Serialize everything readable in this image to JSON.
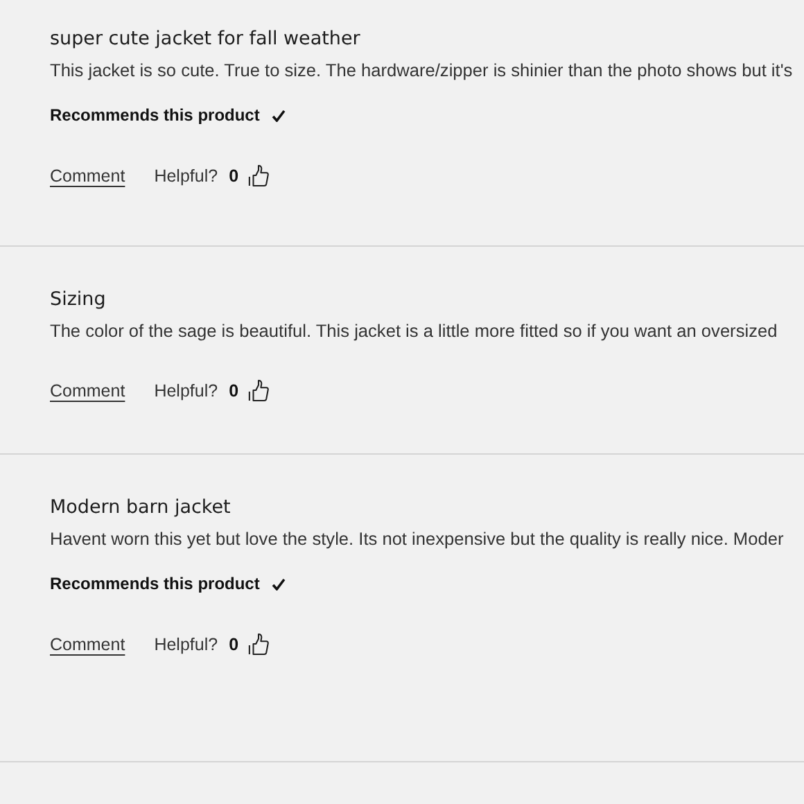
{
  "reviews": [
    {
      "title": "super cute jacket for fall weather",
      "body": "This jacket is so cute. True to size. The hardware/zipper is shinier than the photo shows but it's",
      "recommends": true,
      "recommend_label": "Recommends this product",
      "comment": "Comment",
      "helpful_label": "Helpful?",
      "helpful_count": "0"
    },
    {
      "title": "Sizing",
      "body": "The color of the sage is beautiful. This jacket is a little more fitted so if you want an oversized",
      "recommends": false,
      "comment": "Comment",
      "helpful_label": "Helpful?",
      "helpful_count": "0"
    },
    {
      "title": "Modern barn jacket",
      "body": "Havent worn this yet but love the style. Its not inexpensive but the quality is really nice. Moder",
      "recommends": true,
      "recommend_label": "Recommends this product",
      "comment": "Comment",
      "helpful_label": "Helpful?",
      "helpful_count": "0"
    }
  ]
}
